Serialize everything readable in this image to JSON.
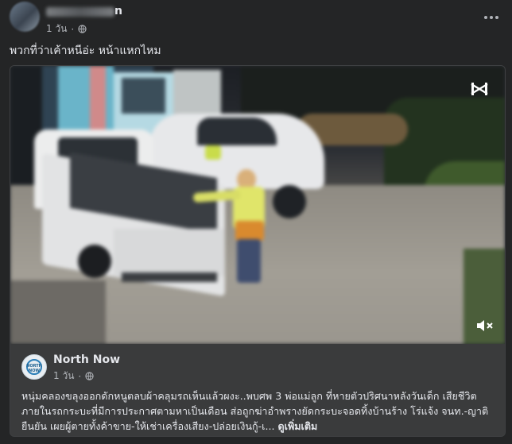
{
  "post": {
    "author_visible_suffix": "n",
    "time": "1 วัน",
    "caption": "พวกที่ว่าเค้าหนีอ่ะ หน้าแหกไหม"
  },
  "icons": {
    "privacy": "globe-icon",
    "menu": "more-options-icon",
    "video_corner": "capcut-icon",
    "mute": "volume-muted-icon"
  },
  "shared": {
    "page_name": "North Now",
    "time": "1 วัน",
    "text": "หนุ่มคลองขลุงออกดักหนูตลบผ้าคลุมรถเห็นแล้วผงะ..พบศพ 3 พ่อแม่ลูก ที่หายตัวปริศนาหลังวันเด็ก เสียชีวิตภายในรถกระบะที่มีการประกาศตามหาเป็นเดือน ส่อถูกฆ่าอำพรางยัดกระบะจอดทิ้งบ้านร้าง โร่แจ้ง จนท.-ญาติยืนยัน เผยผู้ตายทั้งค้าขาย-ให้เช่าเครื่องเสียง-ปล่อยเงินกู้-เ...",
    "see_more": "ดูเพิ่มเติม",
    "avatar_label": "NORTH NOW"
  },
  "colors": {
    "background": "#242526",
    "card": "#3a3b3c",
    "text": "#e4e6eb",
    "secondary_text": "#b0b3b8"
  }
}
